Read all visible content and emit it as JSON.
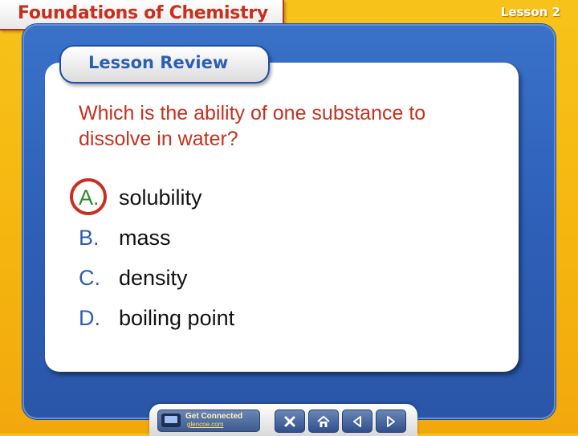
{
  "header": {
    "title": "Foundations of Chemistry",
    "lesson": "Lesson 2"
  },
  "review": {
    "label": "Lesson Review"
  },
  "question": {
    "text": "Which is the ability of one substance to dissolve in water?"
  },
  "choices": [
    {
      "letter": "A.",
      "text": "solubility",
      "selected": true
    },
    {
      "letter": "B.",
      "text": "mass",
      "selected": false
    },
    {
      "letter": "C.",
      "text": "density",
      "selected": false
    },
    {
      "letter": "D.",
      "text": "boiling point",
      "selected": false
    }
  ],
  "nav": {
    "connect_title": "Get Connected",
    "connect_site": "glencoe.com",
    "buttons": [
      "close-icon",
      "home-icon",
      "previous-icon",
      "next-icon"
    ]
  },
  "colors": {
    "frame_yellow": "#f5b40f",
    "panel_blue": "#2e60b8",
    "question_red": "#c8301e",
    "letter_blue": "#2c5fb4",
    "correct_green": "#2e8b2e"
  }
}
